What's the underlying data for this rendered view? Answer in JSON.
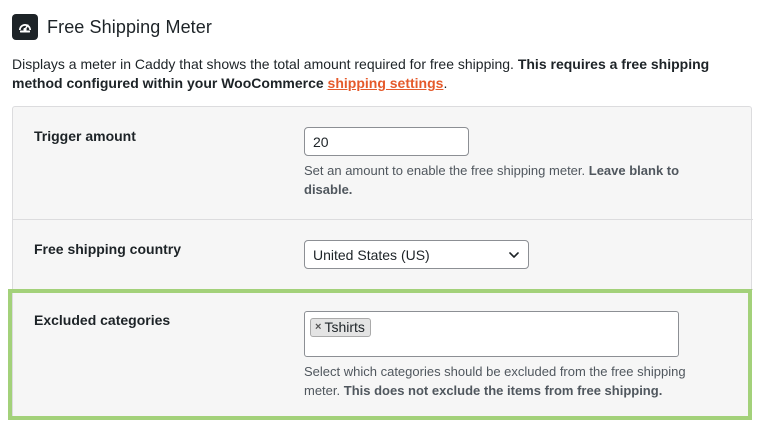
{
  "header": {
    "title": "Free Shipping Meter",
    "icon": "speedometer-icon"
  },
  "description": {
    "text": "Displays a meter in Caddy that shows the total amount required for free shipping. ",
    "bold_text": "This requires a free shipping method configured within your WooCommerce ",
    "link_text": "shipping settings",
    "trailing": "."
  },
  "settings": {
    "trigger": {
      "label": "Trigger amount",
      "value": "20",
      "help_text": "Set an amount to enable the free shipping meter. ",
      "help_bold": "Leave blank to disable."
    },
    "country": {
      "label": "Free shipping country",
      "selected": "United States (US)"
    },
    "excluded": {
      "label": "Excluded categories",
      "tags": [
        {
          "remove": "×",
          "label": "Tshirts"
        }
      ],
      "help_text": "Select which categories should be excluded from the free shipping meter. ",
      "help_bold": "This does not exclude the items from free shipping."
    }
  },
  "colors": {
    "accent_link": "#e55a2b",
    "highlight_border": "#a3d17a",
    "panel_bg": "#f6f6f6"
  }
}
